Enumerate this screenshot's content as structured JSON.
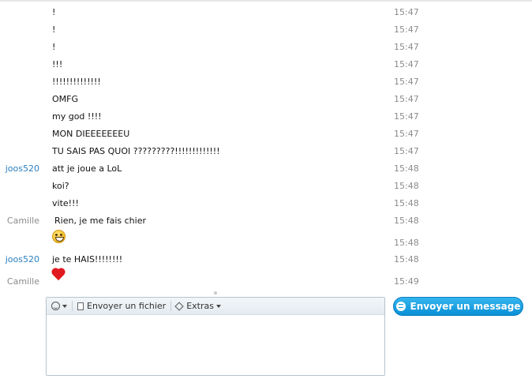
{
  "messages": [
    {
      "sender": "",
      "text": "!",
      "time": "15:47"
    },
    {
      "sender": "",
      "text": "!",
      "time": "15:47"
    },
    {
      "sender": "",
      "text": "!",
      "time": "15:47"
    },
    {
      "sender": "",
      "text": "!!!",
      "time": "15:47"
    },
    {
      "sender": "",
      "text": "!!!!!!!!!!!!!!",
      "time": "15:47"
    },
    {
      "sender": "",
      "text": "OMFG",
      "time": "15:47"
    },
    {
      "sender": "",
      "text": "my god !!!!",
      "time": "15:47"
    },
    {
      "sender": "",
      "text": "MON DIEEEEEEEU",
      "time": "15:47"
    },
    {
      "sender": "",
      "text": "TU SAIS PAS QUOI ?????????!!!!!!!!!!!!!",
      "time": "15:47"
    },
    {
      "sender": "joos520",
      "text": "att je joue a LoL",
      "time": "15:48"
    },
    {
      "sender": "",
      "text": "koi?",
      "time": "15:48"
    },
    {
      "sender": "",
      "text": "vite!!!",
      "time": "15:48"
    },
    {
      "sender": "Camille",
      "text": "Rien, je me fais chier",
      "time": "15:48"
    },
    {
      "sender": "",
      "emoji": "smile-emoji",
      "time": "15:48"
    },
    {
      "sender": "joos520",
      "text": "je te HAIS!!!!!!!!",
      "time": "15:48"
    },
    {
      "sender": "Camille",
      "emoji": "heart-emoji",
      "time": "15:49"
    }
  ],
  "composer": {
    "emoticon_icon": "smiley-icon",
    "send_file_label": "Envoyer un fichier",
    "extras_label": "Extras",
    "input_value": ""
  },
  "send_button": {
    "label": "Envoyer un message",
    "icon": "chat-bubble-icon"
  },
  "colors": {
    "sender_joos": "#2a7fc0",
    "sender_camille": "#8a8a8a",
    "time": "#8c8c8c",
    "send_button": "#1a9fe0"
  }
}
